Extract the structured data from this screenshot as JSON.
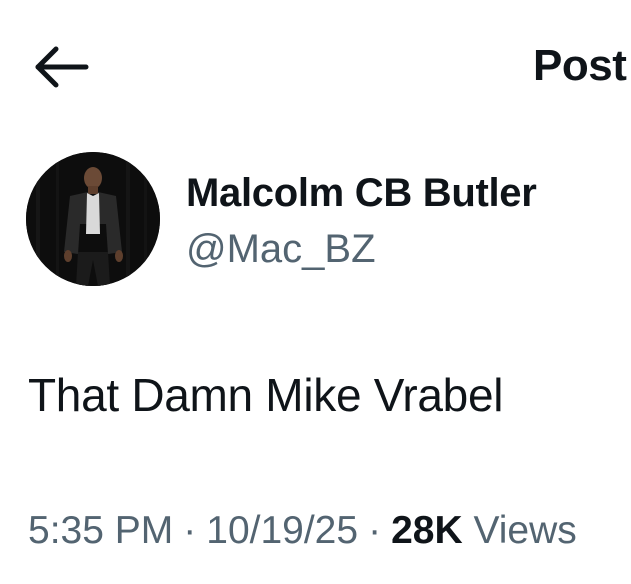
{
  "header": {
    "back_icon": "back-arrow-icon",
    "title": "Post"
  },
  "author": {
    "display_name": "Malcolm CB Butler",
    "handle": "@Mac_BZ"
  },
  "post": {
    "text": "That Damn Mike Vrabel",
    "time": "5:35 PM",
    "date": "10/19/25",
    "separator": "·",
    "views_count": "28K",
    "views_label": "Views"
  },
  "colors": {
    "text_primary": "#0f1419",
    "text_secondary": "#536471",
    "background": "#ffffff"
  }
}
